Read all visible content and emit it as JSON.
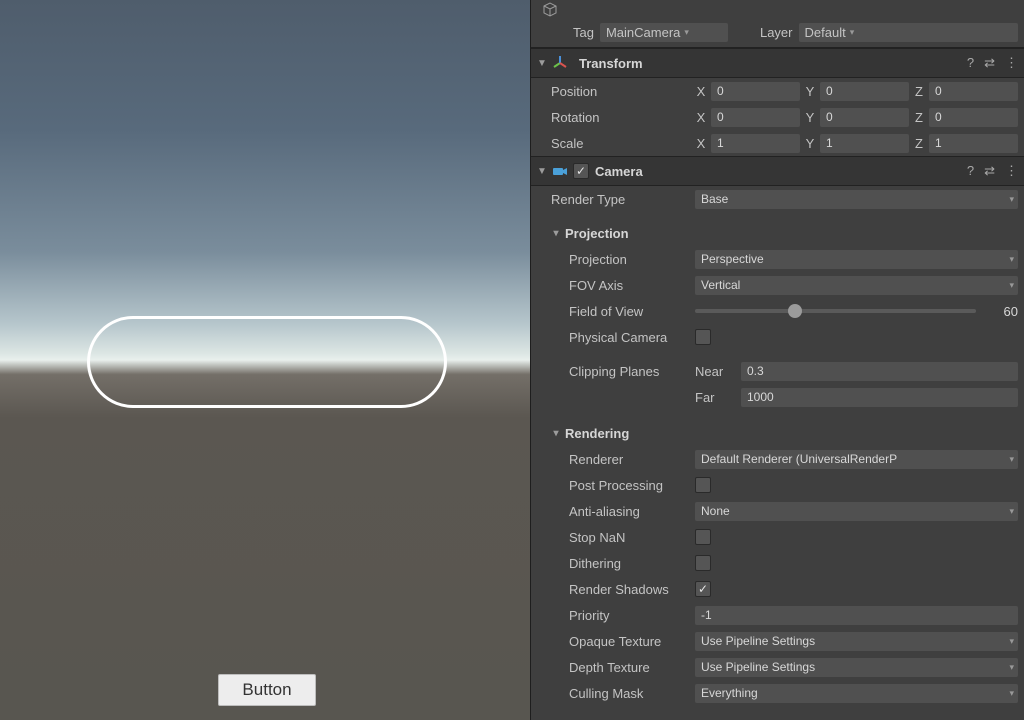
{
  "game_view": {
    "ui_button_label": "Button"
  },
  "header": {
    "tag_label": "Tag",
    "tag_value": "MainCamera",
    "layer_label": "Layer",
    "layer_value": "Default"
  },
  "transform": {
    "title": "Transform",
    "position_label": "Position",
    "rotation_label": "Rotation",
    "scale_label": "Scale",
    "pos": {
      "x": "0",
      "y": "0",
      "z": "0"
    },
    "rot": {
      "x": "0",
      "y": "0",
      "z": "0"
    },
    "scale": {
      "x": "1",
      "y": "1",
      "z": "1"
    }
  },
  "camera": {
    "title": "Camera",
    "enabled": true,
    "render_type_label": "Render Type",
    "render_type": "Base",
    "projection_header": "Projection",
    "projection_label": "Projection",
    "projection": "Perspective",
    "fov_axis_label": "FOV Axis",
    "fov_axis": "Vertical",
    "fov_label": "Field of View",
    "fov": "60",
    "fov_slider_pos_percent": 33,
    "physical_label": "Physical Camera",
    "physical": false,
    "clipping_label": "Clipping Planes",
    "near_label": "Near",
    "near": "0.3",
    "far_label": "Far",
    "far": "1000",
    "rendering_header": "Rendering",
    "renderer_label": "Renderer",
    "renderer": "Default Renderer (UniversalRenderP",
    "postproc_label": "Post Processing",
    "postproc": false,
    "aa_label": "Anti-aliasing",
    "aa": "None",
    "stopnan_label": "Stop NaN",
    "stopnan": false,
    "dither_label": "Dithering",
    "dither": false,
    "shadows_label": "Render Shadows",
    "shadows": true,
    "priority_label": "Priority",
    "priority": "-1",
    "opaque_label": "Opaque Texture",
    "opaque": "Use Pipeline Settings",
    "depth_label": "Depth Texture",
    "depth": "Use Pipeline Settings",
    "culling_label": "Culling Mask",
    "culling": "Everything"
  },
  "glyphs": {
    "check": "✓",
    "help": "?",
    "preset": "⇄",
    "menu": "⋮",
    "caret": "▾",
    "tri_open": "▼",
    "tri_open_sub": "▾"
  }
}
